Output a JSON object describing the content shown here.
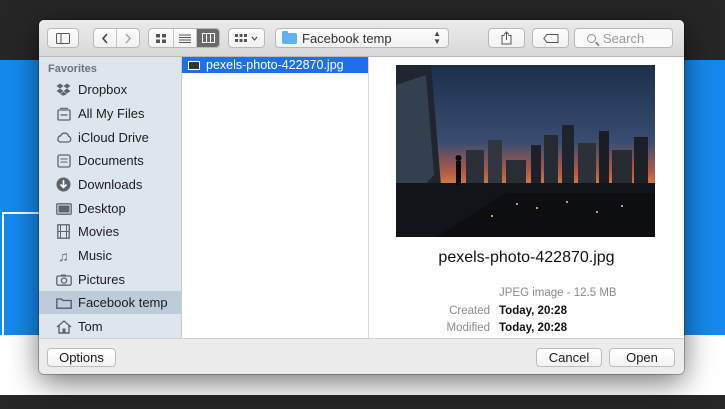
{
  "dialog": {
    "path_popup": "Facebook temp",
    "search_placeholder": "Search"
  },
  "sidebar": {
    "heading": "Favorites",
    "items": [
      {
        "label": "Dropbox",
        "icon": "dropbox-icon"
      },
      {
        "label": "All My Files",
        "icon": "all-files-icon"
      },
      {
        "label": "iCloud Drive",
        "icon": "cloud-icon"
      },
      {
        "label": "Documents",
        "icon": "documents-icon"
      },
      {
        "label": "Downloads",
        "icon": "downloads-icon"
      },
      {
        "label": "Desktop",
        "icon": "desktop-icon"
      },
      {
        "label": "Movies",
        "icon": "movies-icon"
      },
      {
        "label": "Music",
        "icon": "music-icon"
      },
      {
        "label": "Pictures",
        "icon": "pictures-icon"
      },
      {
        "label": "Facebook temp",
        "icon": "folder-icon",
        "selected": true
      },
      {
        "label": "Tom",
        "icon": "home-icon"
      }
    ]
  },
  "files": [
    {
      "name": "pexels-photo-422870.jpg",
      "selected": true
    }
  ],
  "preview": {
    "filename": "pexels-photo-422870.jpg",
    "kind": "JPEG image - 12.5 MB",
    "details": [
      {
        "label": "Created",
        "value": "Today, 20:28"
      },
      {
        "label": "Modified",
        "value": "Today, 20:28"
      }
    ]
  },
  "buttons": {
    "options": "Options",
    "cancel": "Cancel",
    "open": "Open"
  },
  "colors": {
    "selection": "#1f6fe8",
    "sidebar_bg": "#dde5ed",
    "sidebar_selected": "#bdcbdb",
    "page_accent": "#1589ee"
  }
}
